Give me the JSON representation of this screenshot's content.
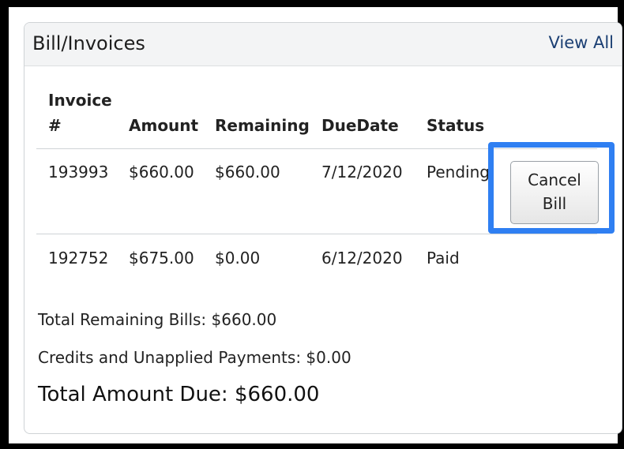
{
  "panel": {
    "title": "Bill/Invoices",
    "view_all_label": "View All"
  },
  "table": {
    "headers": {
      "invoice_line1": "Invoice",
      "invoice_line2": "#",
      "amount": "Amount",
      "remaining": "Remaining",
      "due_date": "DueDate",
      "status": "Status"
    },
    "rows": [
      {
        "invoice": "193993",
        "amount": "$660.00",
        "remaining": "$660.00",
        "due_date": "7/12/2020",
        "status": "Pending",
        "action_line1": "Cancel",
        "action_line2": "Bill"
      },
      {
        "invoice": "192752",
        "amount": "$675.00",
        "remaining": "$0.00",
        "due_date": "6/12/2020",
        "status": "Paid"
      }
    ]
  },
  "summary": {
    "total_remaining": "Total Remaining Bills: $660.00",
    "credits": "Credits and Unapplied Payments: $0.00",
    "total_due": "Total Amount Due: $660.00"
  },
  "colors": {
    "highlight": "#2f7ff2",
    "link": "#1b3f73"
  }
}
